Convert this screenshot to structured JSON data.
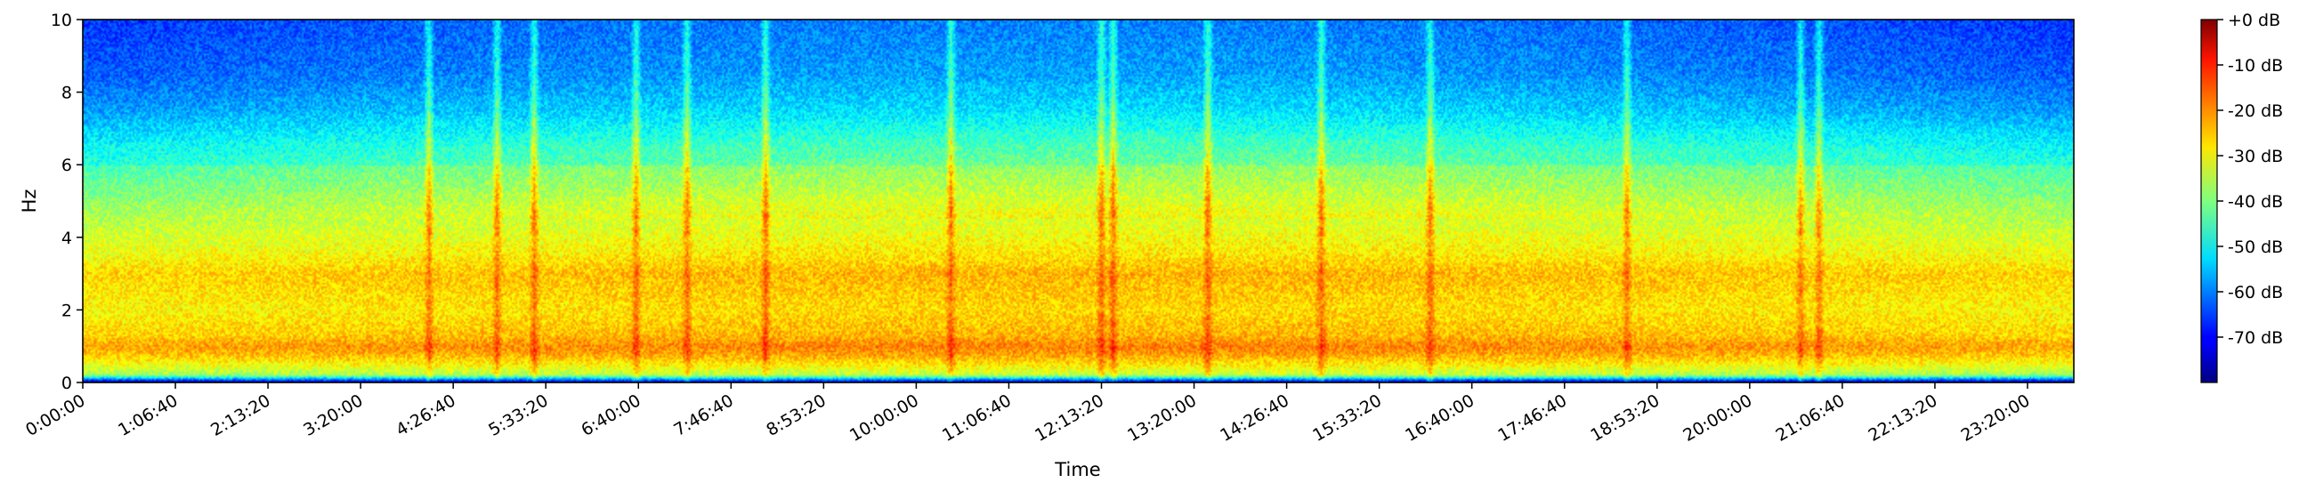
{
  "chart_data": {
    "type": "heatmap",
    "title": "",
    "xlabel": "Time",
    "ylabel": "Hz",
    "ylim": [
      0,
      10
    ],
    "y_ticks": [
      "0",
      "2",
      "4",
      "6",
      "8",
      "10"
    ],
    "x_ticks": [
      "0:00:00",
      "1:06:40",
      "2:13:20",
      "3:20:00",
      "4:26:40",
      "5:33:20",
      "6:40:00",
      "7:46:40",
      "8:53:20",
      "10:00:00",
      "11:06:40",
      "12:13:20",
      "13:20:00",
      "14:26:40",
      "15:33:20",
      "16:40:00",
      "17:46:40",
      "18:53:20",
      "20:00:00",
      "21:06:40",
      "22:13:20",
      "23:20:00"
    ],
    "x_tick_seconds": [
      0,
      4000,
      8000,
      12000,
      16000,
      20000,
      24000,
      28000,
      32000,
      36000,
      40000,
      44000,
      48000,
      52000,
      56000,
      60000,
      64000,
      68000,
      72000,
      76000,
      80000,
      84000
    ],
    "xlim_seconds": [
      0,
      86000
    ],
    "colorbar": {
      "colormap": "jet",
      "range_db": [
        -80,
        0
      ],
      "ticks": [
        "+0 dB",
        "-10 dB",
        "-20 dB",
        "-30 dB",
        "-40 dB",
        "-50 dB",
        "-60 dB",
        "-70 dB"
      ],
      "tick_values": [
        0,
        -10,
        -20,
        -30,
        -40,
        -50,
        -60,
        -70
      ]
    },
    "intensity_profile": {
      "freq_hz": [
        0,
        0.2,
        0.5,
        0.8,
        1.0,
        1.3,
        2.0,
        3.0,
        3.5,
        4.5,
        5.5,
        6.5,
        7.5,
        8.5,
        10.0
      ],
      "level_db": [
        -78,
        -38,
        -31,
        -25,
        -23,
        -27,
        -30,
        -27,
        -31,
        -36,
        -42,
        -47,
        -55,
        -60,
        -63
      ]
    },
    "transient_events_seconds": [
      14950,
      17900,
      19500,
      23900,
      26100,
      29500,
      37500,
      44000,
      44500,
      48600,
      53500,
      58200,
      66700,
      74200,
      75000
    ]
  }
}
